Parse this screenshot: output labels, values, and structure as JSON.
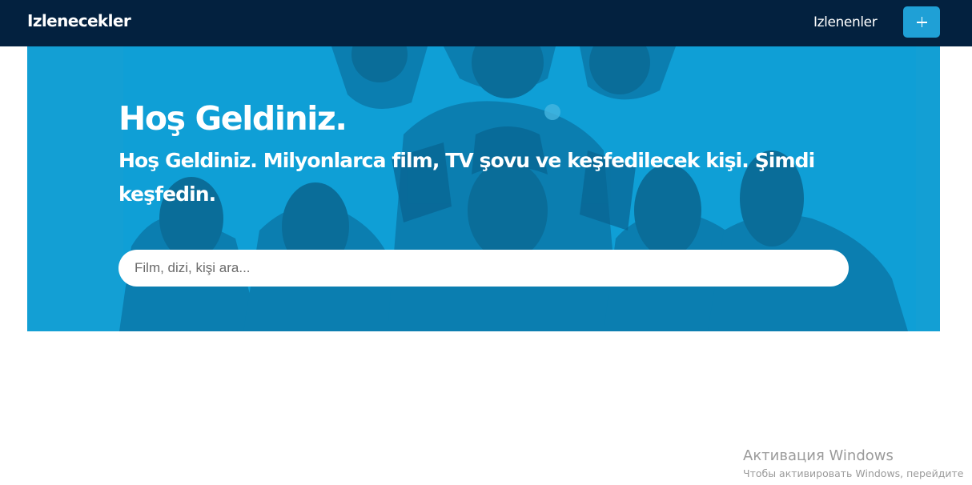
{
  "navbar": {
    "brand": "Izlenecekler",
    "watched_link": "Izlenenler",
    "add_button_icon": "plus-icon",
    "background_color": "#03213f",
    "accent_color": "#1fa0d6"
  },
  "hero": {
    "title": "Hoş Geldiniz.",
    "subtitle": "Hoş Geldiniz. Milyonlarca film, TV şovu ve keşfedilecek kişi. Şimdi keşfedin.",
    "search_placeholder": "Film, dizi, kişi ara...",
    "search_value": "",
    "tint_color": "#0f9fd6"
  },
  "windows_watermark": {
    "title": "Активация Windows",
    "subtitle": "Чтобы активировать Windows, перейдите"
  }
}
